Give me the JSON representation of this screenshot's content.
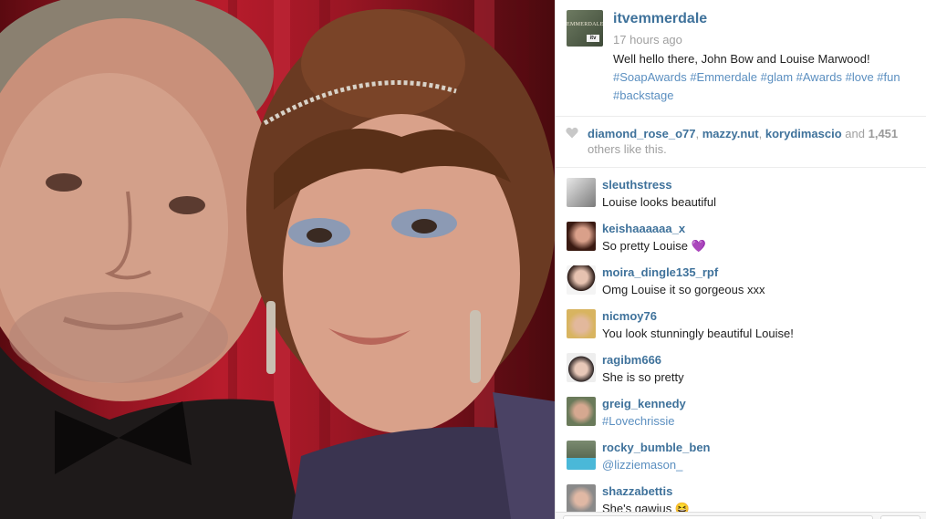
{
  "post": {
    "username": "itvemmerdale",
    "time_ago": "17 hours ago",
    "caption_text": "Well hello there, John Bow and Louise Marwood!",
    "caption_tags": "#SoapAwards #Emmerdale #glam #Awards #love #fun #backstage",
    "avatar_label": "EMMERDALE",
    "avatar_badge": "itv"
  },
  "likes": {
    "user1": "diamond_rose_o77",
    "sep1": ", ",
    "user2": "mazzy.nut",
    "sep2": ", ",
    "user3": "korydimascio",
    "and_text": " and ",
    "count": "1,451",
    "suffix": " others like this."
  },
  "comments": [
    {
      "user": "sleuthstress",
      "text": "Louise looks beautiful"
    },
    {
      "user": "keishaaaaaa_x",
      "text": "So pretty Louise 💜"
    },
    {
      "user": "moira_dingle135_rpf",
      "text": "Omg Louise it so gorgeous xxx"
    },
    {
      "user": "nicmoy76",
      "text": "You look stunningly beautiful Louise!"
    },
    {
      "user": "ragibm666",
      "text": "She is so pretty"
    },
    {
      "user": "greig_kennedy",
      "text": "#Lovechrissie"
    },
    {
      "user": "rocky_bumble_ben",
      "text": "@lizziemason_"
    },
    {
      "user": "shazzabettis",
      "text": "She's gawjus 😆"
    }
  ],
  "colors": {
    "link": "#3f729b",
    "tag": "#5b8fc0",
    "muted": "#a0a0a0",
    "curtain": "#b81c2c"
  },
  "icons": {
    "like": "heart-icon"
  }
}
